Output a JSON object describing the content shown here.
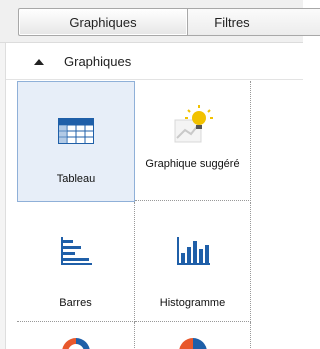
{
  "tabs": [
    {
      "label": "Graphiques",
      "active": true
    },
    {
      "label": "Filtres",
      "active": false
    }
  ],
  "section": {
    "title": "Graphiques",
    "expanded": true
  },
  "chart_types": [
    {
      "label": "Tableau",
      "icon": "table-grid-icon",
      "selected": true
    },
    {
      "label": "Graphique suggéré",
      "icon": "suggested-chart-lightbulb-icon",
      "selected": false
    },
    {
      "label": "Barres",
      "icon": "horizontal-bar-chart-icon",
      "selected": false
    },
    {
      "label": "Histogramme",
      "icon": "vertical-bar-chart-icon",
      "selected": false
    },
    {
      "label": "",
      "icon": "donut-chart-icon",
      "selected": false
    },
    {
      "label": "",
      "icon": "pie-chart-icon",
      "selected": false
    }
  ],
  "colors": {
    "accent": "#1f5fa8",
    "selected_bg": "#e7eef8",
    "selected_border": "#8fb0d8",
    "bulb": "#f2c200",
    "donut_orange": "#e8582c"
  }
}
